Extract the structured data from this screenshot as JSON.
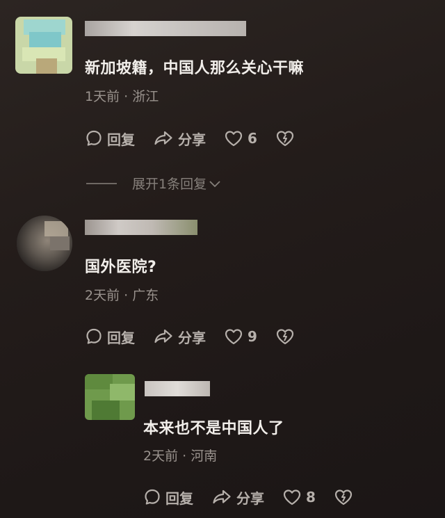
{
  "comments": [
    {
      "text": "新加坡籍，中国人那么关心干嘛",
      "meta": "1天前 · 浙江",
      "reply_label": "回复",
      "share_label": "分享",
      "likes": "6",
      "expand_label": "展开1条回复"
    },
    {
      "text": "国外医院?",
      "meta": "2天前 · 广东",
      "reply_label": "回复",
      "share_label": "分享",
      "likes": "9"
    },
    {
      "text": "本来也不是中国人了",
      "meta": "2天前 · 河南",
      "reply_label": "回复",
      "share_label": "分享",
      "likes": "8"
    }
  ],
  "colors": {
    "background": "#231c1a",
    "text": "#f1eeea",
    "meta": "#9a938e",
    "action": "#b6b0ab"
  }
}
